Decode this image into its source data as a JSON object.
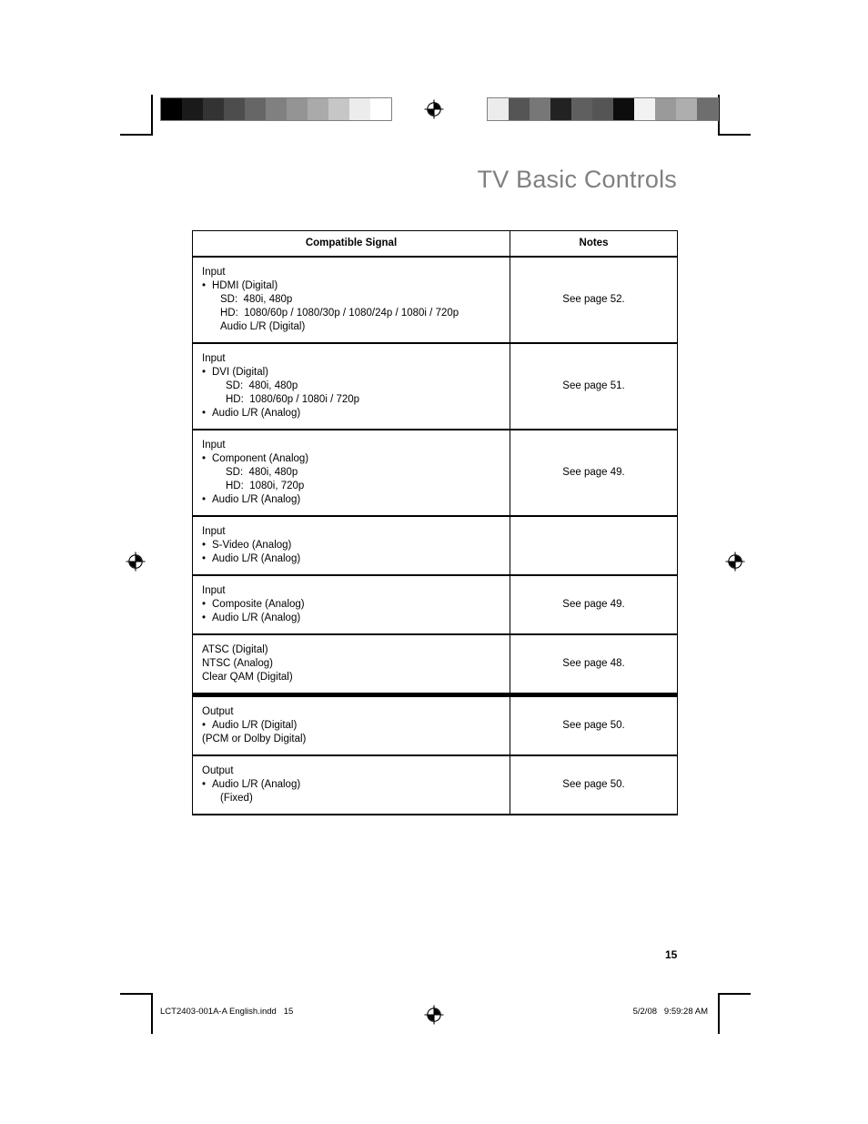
{
  "document": {
    "title": "TV Basic Controls",
    "page_number": "15",
    "title_color": "#808080"
  },
  "footer": {
    "file_slug": "LCT2403-001A-A English.indd   15",
    "timestamp": "5/2/08   9:59:28 AM"
  },
  "calibration": {
    "left_bar": {
      "name": "grayscale-ramp",
      "swatches": [
        "#000000",
        "#1a1a1a",
        "#333333",
        "#4d4d4d",
        "#666666",
        "#808080",
        "#949494",
        "#aaaaaa",
        "#c6c6c6",
        "#ececec",
        "#ffffff"
      ]
    },
    "right_bar": {
      "name": "grayscale-scramble",
      "swatches": [
        "#ececec",
        "#555555",
        "#777777",
        "#222222",
        "#5f5f5f",
        "#555555",
        "#0d0d0d",
        "#f2f2f2",
        "#9a9a9a",
        "#aeaeae",
        "#6e6e6e"
      ]
    }
  },
  "table": {
    "headers": {
      "signal": "Compatible Signal",
      "notes": "Notes"
    },
    "rows": [
      {
        "signal_lines": [
          {
            "style": "plain",
            "text": "Input"
          },
          {
            "style": "bullet",
            "text": "HDMI (Digital)"
          },
          {
            "style": "indent1",
            "text": "SD:  480i, 480p"
          },
          {
            "style": "indent1",
            "text": "HD:  1080/60p / 1080/30p / 1080/24p / 1080i / 720p"
          },
          {
            "style": "indent1",
            "text": "Audio L/R (Digital)"
          }
        ],
        "notes": "See page 52.",
        "section_break": false
      },
      {
        "signal_lines": [
          {
            "style": "plain",
            "text": "Input"
          },
          {
            "style": "bullet",
            "text": "DVI (Digital)"
          },
          {
            "style": "indent2",
            "text": "SD:  480i, 480p"
          },
          {
            "style": "indent2",
            "text": "HD:  1080/60p / 1080i / 720p"
          },
          {
            "style": "bullet",
            "text": "Audio L/R (Analog)"
          }
        ],
        "notes": "See page 51.",
        "section_break": false
      },
      {
        "signal_lines": [
          {
            "style": "plain",
            "text": "Input"
          },
          {
            "style": "bullet",
            "text": "Component (Analog)"
          },
          {
            "style": "indent2",
            "text": "SD:  480i, 480p"
          },
          {
            "style": "indent2",
            "text": "HD:  1080i, 720p"
          },
          {
            "style": "bullet",
            "text": "Audio L/R (Analog)"
          }
        ],
        "notes": "See page 49.",
        "section_break": false
      },
      {
        "signal_lines": [
          {
            "style": "plain",
            "text": "Input"
          },
          {
            "style": "bullet",
            "text": "S-Video (Analog)"
          },
          {
            "style": "bullet",
            "text": "Audio L/R (Analog)"
          }
        ],
        "notes": "",
        "section_break": false
      },
      {
        "signal_lines": [
          {
            "style": "plain",
            "text": "Input"
          },
          {
            "style": "bullet",
            "text": "Composite (Analog)"
          },
          {
            "style": "bullet",
            "text": "Audio L/R (Analog)"
          }
        ],
        "notes": "See page 49.",
        "section_break": false
      },
      {
        "signal_lines": [
          {
            "style": "plain",
            "text": "ATSC (Digital)"
          },
          {
            "style": "plain",
            "text": "NTSC (Analog)"
          },
          {
            "style": "plain",
            "text": "Clear QAM (Digital)"
          }
        ],
        "notes": "See page 48.",
        "section_break": false
      },
      {
        "signal_lines": [
          {
            "style": "plain",
            "text": "Output"
          },
          {
            "style": "bullet",
            "text": "Audio L/R (Digital)"
          },
          {
            "style": "plain",
            "text": "(PCM or Dolby Digital)"
          }
        ],
        "notes": "See page 50.",
        "section_break": true
      },
      {
        "signal_lines": [
          {
            "style": "plain",
            "text": "Output"
          },
          {
            "style": "bullet",
            "text": "Audio L/R (Analog)"
          },
          {
            "style": "indent1",
            "text": "(Fixed)"
          }
        ],
        "notes": "See page 50.",
        "section_break": false
      }
    ]
  }
}
